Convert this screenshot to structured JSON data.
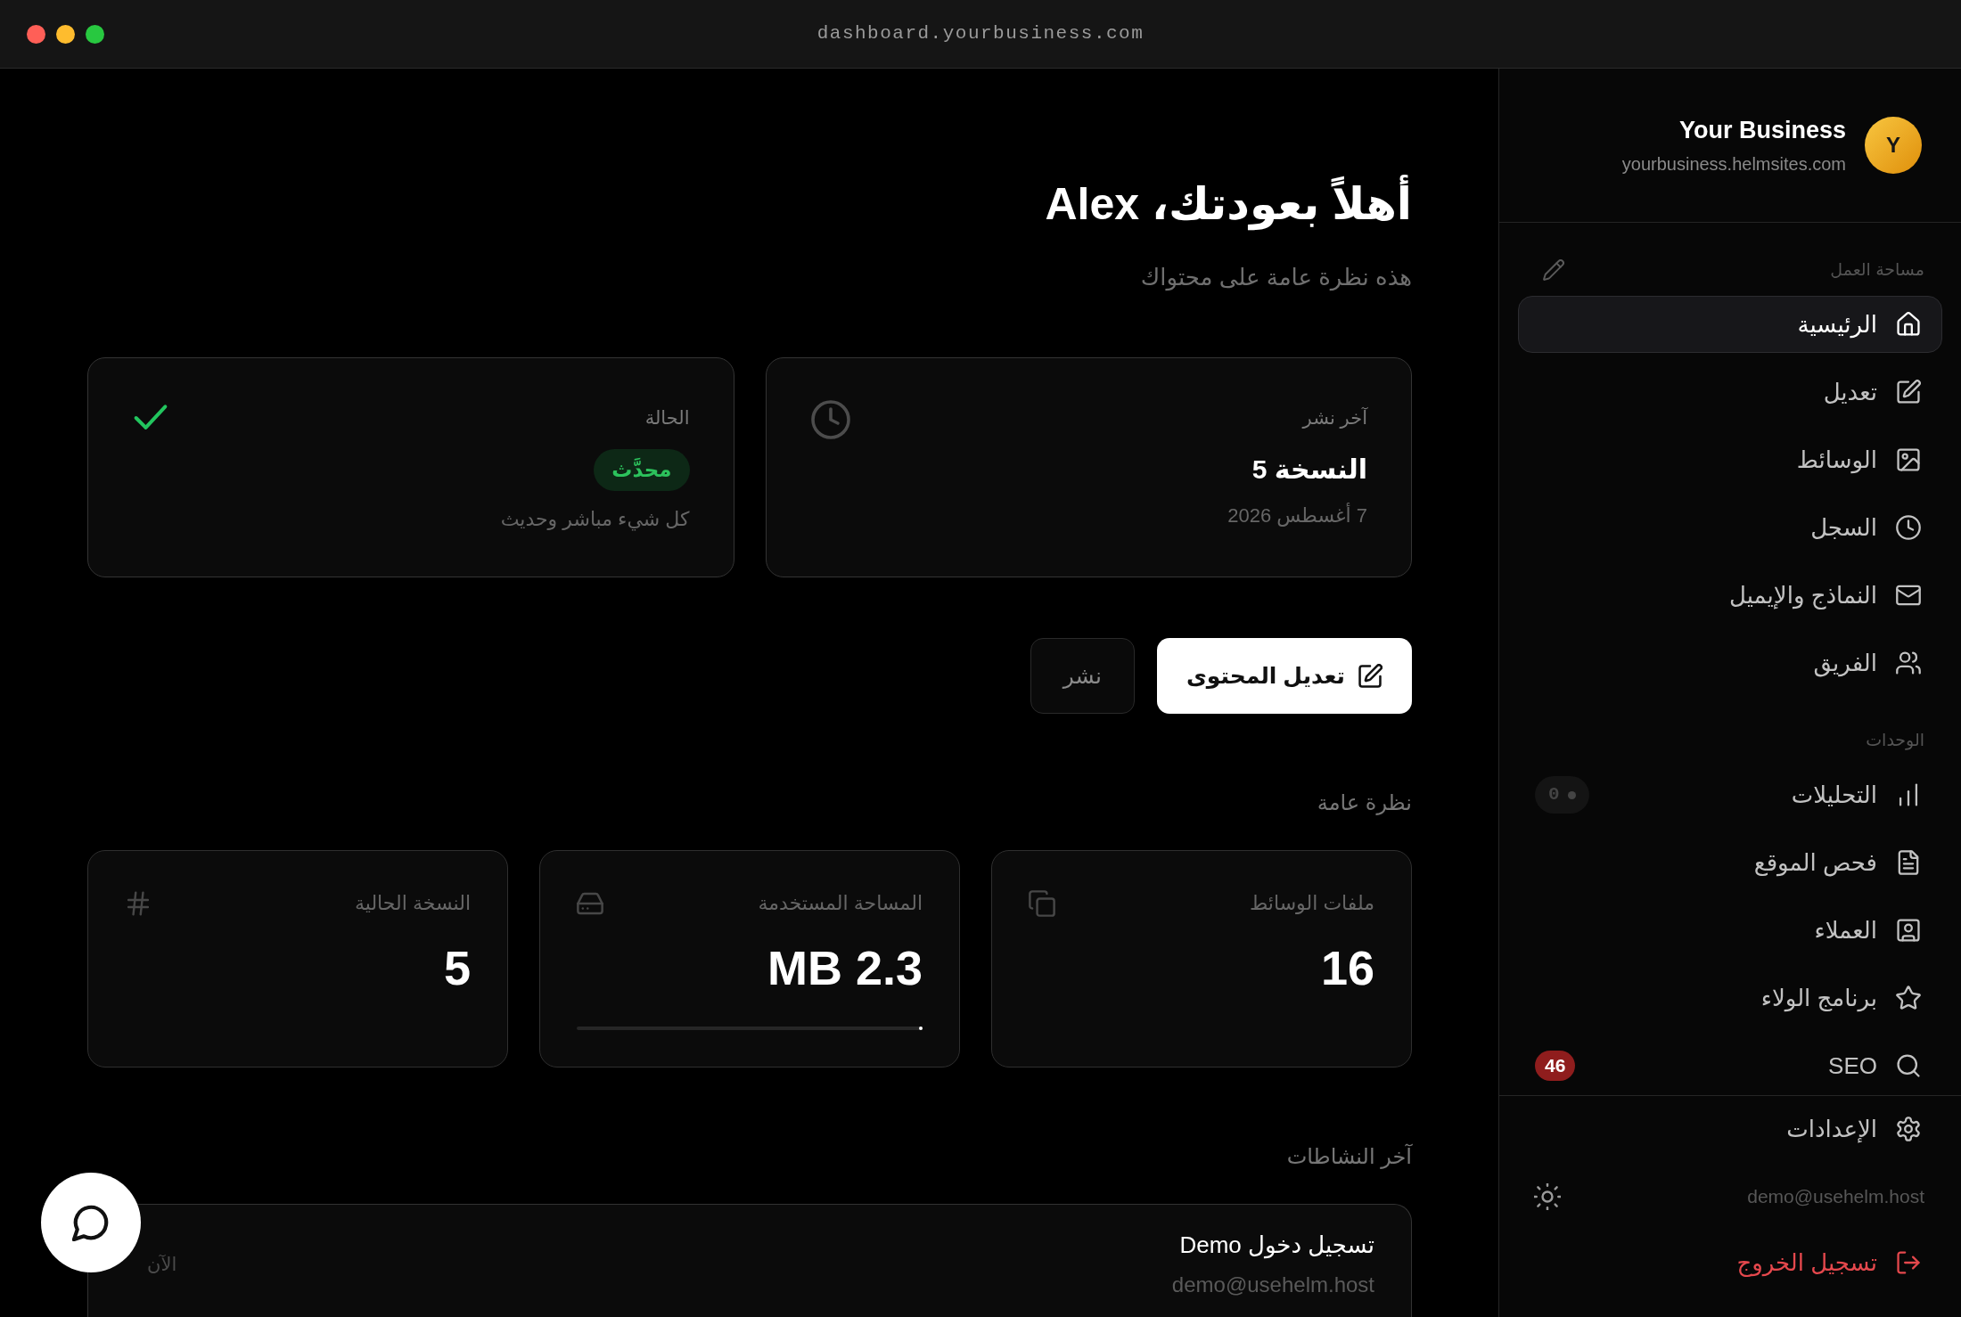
{
  "window": {
    "url": "dashboard.yourbusiness.com"
  },
  "sidebar": {
    "business": {
      "avatar_letter": "Y",
      "name": "Your Business",
      "domain": "yourbusiness.helmsites.com"
    },
    "sections": [
      {
        "label": "مساحة العمل",
        "items": [
          {
            "label": "الرئيسية",
            "selected": true
          },
          {
            "label": "تعديل",
            "selected": false
          },
          {
            "label": "الوسائط",
            "selected": false
          },
          {
            "label": "السجل",
            "selected": false
          },
          {
            "label": "النماذج والإيميل",
            "selected": false
          },
          {
            "label": "الفريق",
            "selected": false
          }
        ]
      },
      {
        "label": "الوحدات",
        "items": [
          {
            "label": "التحليلات",
            "selected": false,
            "badge": {
              "kind": "status",
              "text": "0"
            }
          },
          {
            "label": "فحص الموقع",
            "selected": false
          },
          {
            "label": "العملاء",
            "selected": false
          },
          {
            "label": "برنامج الولاء",
            "selected": false
          },
          {
            "label": "SEO",
            "selected": false,
            "badge": {
              "kind": "count",
              "text": "46"
            }
          }
        ]
      }
    ],
    "footer": {
      "settings": "الإعدادات",
      "email": "demo@usehelm.host",
      "logout": "تسجيل الخروج"
    }
  },
  "main": {
    "title": "أهلاً بعودتك، Alex",
    "subtitle": "هذه نظرة عامة على محتواك",
    "summary_cards": [
      {
        "kind": "publish",
        "label": "آخر نشر",
        "value": "النسخة 5",
        "detail": "7 أغسطس 2026"
      },
      {
        "kind": "status",
        "label": "الحالة",
        "value": "محدَّث",
        "detail": "كل شيء مباشر وحديث"
      }
    ],
    "actions": [
      {
        "kind": "primary",
        "label": "تعديل المحتوى"
      },
      {
        "kind": "secondary",
        "label": "نشر"
      }
    ],
    "overview": {
      "heading": "نظرة عامة",
      "stats": [
        {
          "label": "ملفات الوسائط",
          "value": "16"
        },
        {
          "label": "المساحة المستخدمة",
          "value": "2.3 MB",
          "level": 0.01
        },
        {
          "label": "النسخة الحالية",
          "value": "5"
        }
      ]
    },
    "activity": {
      "heading": "آخر النشاطات",
      "items": [
        {
          "title": "تسجيل دخول Demo",
          "detail": "demo@usehelm.host",
          "time": "الآن"
        }
      ]
    }
  }
}
